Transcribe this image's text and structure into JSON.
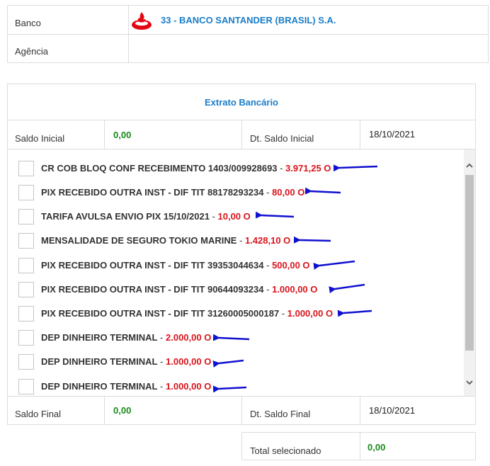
{
  "bank": {
    "label": "Banco",
    "value": "33 - BANCO SANTANDER (BRASIL) S.A.",
    "agency_label": "Agência",
    "agency_value": ""
  },
  "statement": {
    "title": "Extrato Bancário",
    "opening_balance_label": "Saldo Inicial",
    "opening_balance_value": "0,00",
    "opening_date_label": "Dt. Saldo Inicial",
    "opening_date_value": "18/10/2021",
    "closing_balance_label": "Saldo Final",
    "closing_balance_value": "0,00",
    "closing_date_label": "Dt. Saldo Final",
    "closing_date_value": "18/10/2021",
    "total_label": "Total selecionado",
    "total_value": "0,00"
  },
  "entries": [
    {
      "desc": "CR COB BLOQ CONF RECEBIMENTO 1403/009928693",
      "sep": " - ",
      "amount": "3.971,25 O"
    },
    {
      "desc": "PIX RECEBIDO OUTRA INST - DIF TIT 88178293234",
      "sep": " - ",
      "amount": "80,00 O"
    },
    {
      "desc": "TARIFA AVULSA ENVIO PIX 15/10/2021",
      "sep": " - ",
      "amount": "10,00 O"
    },
    {
      "desc": "MENSALIDADE DE SEGURO TOKIO MARINE",
      "sep": " - ",
      "amount": "1.428,10 O"
    },
    {
      "desc": "PIX RECEBIDO OUTRA INST - DIF TIT 39353044634",
      "sep": " - ",
      "amount": "500,00 O"
    },
    {
      "desc": "PIX RECEBIDO OUTRA INST - DIF TIT 90644093234",
      "sep": " - ",
      "amount": "1.000,00 O"
    },
    {
      "desc": "PIX RECEBIDO OUTRA INST - DIF TIT 31260005000187",
      "sep": " - ",
      "amount": "1.000,00 O"
    },
    {
      "desc": "DEP DINHEIRO TERMINAL",
      "sep": " - ",
      "amount": "2.000,00 O"
    },
    {
      "desc": "DEP DINHEIRO TERMINAL",
      "sep": " - ",
      "amount": "1.000,00 O"
    },
    {
      "desc": "DEP DINHEIRO TERMINAL",
      "sep": " - ",
      "amount": "1.000,00 O"
    }
  ],
  "icons": {
    "bank_logo": "santander-flame-icon",
    "annotation": "blue-arrow-icon",
    "scroll_up": "chevron-up-icon",
    "scroll_down": "chevron-down-icon"
  },
  "colors": {
    "link_blue": "#1a7dc9",
    "amount_red": "#d9141c",
    "balance_green": "#1a8a1a",
    "logo_red": "#e30613",
    "arrow_blue": "#1010d0"
  }
}
